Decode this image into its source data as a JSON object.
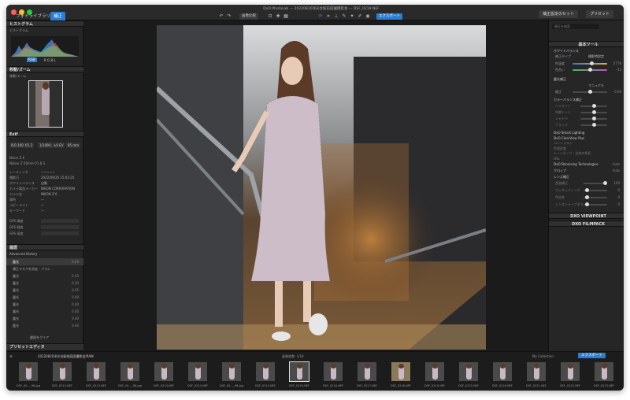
{
  "tabs": {
    "library": "フォトライブラリ",
    "customize": "補正"
  },
  "toolbar": {
    "compare": "画像比較",
    "export_btn": "エクスポート"
  },
  "window_title": "DxO PhotoLab — 20220820洋光台駅前庭園撮影会 — DSF_0219.NEF",
  "right_buttons": {
    "preset": "補正設定のセット",
    "presets": "プリセット"
  },
  "left_panel": {
    "histogram": {
      "title": "ヒストグラム",
      "subtitle": "ヒストグラム",
      "channels": "R G B L",
      "mode": "RGB"
    },
    "navigator": {
      "title": "移動/ズーム",
      "subtitle": "移動/ズーム"
    },
    "exif": {
      "title": "Exif",
      "chips": [
        "ISO 100",
        "f/1.2",
        "1/1000 s",
        "±0 EV",
        "85 mm"
      ],
      "camera": "Nikon Z 6",
      "lens": "Nikkor Z 50mm f/1.8 S",
      "rows": [
        {
          "k": "レーティング",
          "v": "☆☆☆☆☆"
        },
        {
          "k": "撮影日",
          "v": "2022/08/20 15:03:25"
        },
        {
          "k": "ホワイトバランス",
          "v": "自動"
        },
        {
          "k": "カメラ製造メーカー",
          "v": "NIKON CORPORATION"
        },
        {
          "k": "カメラ名",
          "v": "NIKON Z 6"
        },
        {
          "k": "場所",
          "v": "—"
        },
        {
          "k": "コピーライト",
          "v": "—"
        },
        {
          "k": "キーワード",
          "v": "—"
        }
      ],
      "gps": [
        "GPS 緯度",
        "GPS 経度",
        "GPS 高度"
      ]
    },
    "history": {
      "title": "履歴",
      "sub": "Advanced History",
      "items": [
        {
          "k": "露光",
          "v": "0.29"
        },
        {
          "k": "補正マスクを消去 - ブラシ",
          "v": ""
        },
        {
          "k": "露光",
          "v": "0.45"
        },
        {
          "k": "露光",
          "v": "0.30"
        },
        {
          "k": "露光",
          "v": "0.45"
        },
        {
          "k": "露光",
          "v": "0.40"
        },
        {
          "k": "露光",
          "v": "0.40"
        },
        {
          "k": "露光",
          "v": "0.40"
        },
        {
          "k": "露光",
          "v": "0.40"
        },
        {
          "k": "露光",
          "v": "0.40"
        }
      ],
      "footer": "履歴をクリア"
    },
    "presets_editor": "プリセットエディタ"
  },
  "right_panel": {
    "search_placeholder": "補正を検索",
    "basic_tools": "基本ツール",
    "wb": {
      "title": "ホワイトバランス",
      "row1": "補正タイプ",
      "row1v": "撮影時設定",
      "temp": "色温度",
      "temp_v": "5778",
      "tint": "色合い",
      "tint_v": "-13"
    },
    "exposure": {
      "title": "露光補正",
      "row": "補正",
      "row_v": "0.00",
      "mode": "マニュアル"
    },
    "tone": {
      "title": "カラーバランス補正",
      "rows": [
        "ハイライト",
        "中間トーン",
        "シャドウ",
        "ブラック"
      ]
    },
    "smart": [
      "DxO Smart Lighting",
      "DxO ClearView Plus",
      "コントラスト",
      "色相彩度",
      "トーンカーブ - 全体の色彩",
      "HSL"
    ],
    "denoise": {
      "title": "DxO Denoising Technologies",
      "value": "Auto"
    },
    "crop": {
      "title": "クロップ",
      "value": "Auto"
    },
    "lens": {
      "title": "レンズ補正",
      "rows": [
        "歪曲補正",
        "ヴィネッティング",
        "色収差",
        "レンズシャープネス"
      ],
      "vals": [
        "100",
        "0",
        "0",
        "0"
      ]
    },
    "viewpoint": "DXO VIEWPOINT",
    "filmpack": "DXO FILMPACK"
  },
  "filmstrip": {
    "folder": "20220820洋光台駅前庭園撮影会/RAW",
    "count": "画像枚数: 1/19",
    "collection": "My Collection",
    "export": "エクスポート",
    "items": [
      "DSF_00…_98.jpg",
      "DSF_0213.NEF",
      "DSF_0213.NEF",
      "DSF_00…_98.jpg",
      "DSF_0214.NEF",
      "DSF_0214.NEF",
      "DSF_00…_98.jpg",
      "DSF_0215.NEF",
      "DSF_0219.NEF",
      "DSF_0216.NEF",
      "DSF_0217.NEF",
      "DSF_0218.NEF",
      "DSF_0219.NEF",
      "DSF_0220.NEF",
      "DSF_0220.NEF",
      "DSF_0221.NEF",
      "DSF_0222.NEF",
      "DSF_0223.NEF"
    ]
  },
  "colors": {
    "accent": "#2a7fd4",
    "bg": "#1e1e1e",
    "panel": "#262626"
  }
}
